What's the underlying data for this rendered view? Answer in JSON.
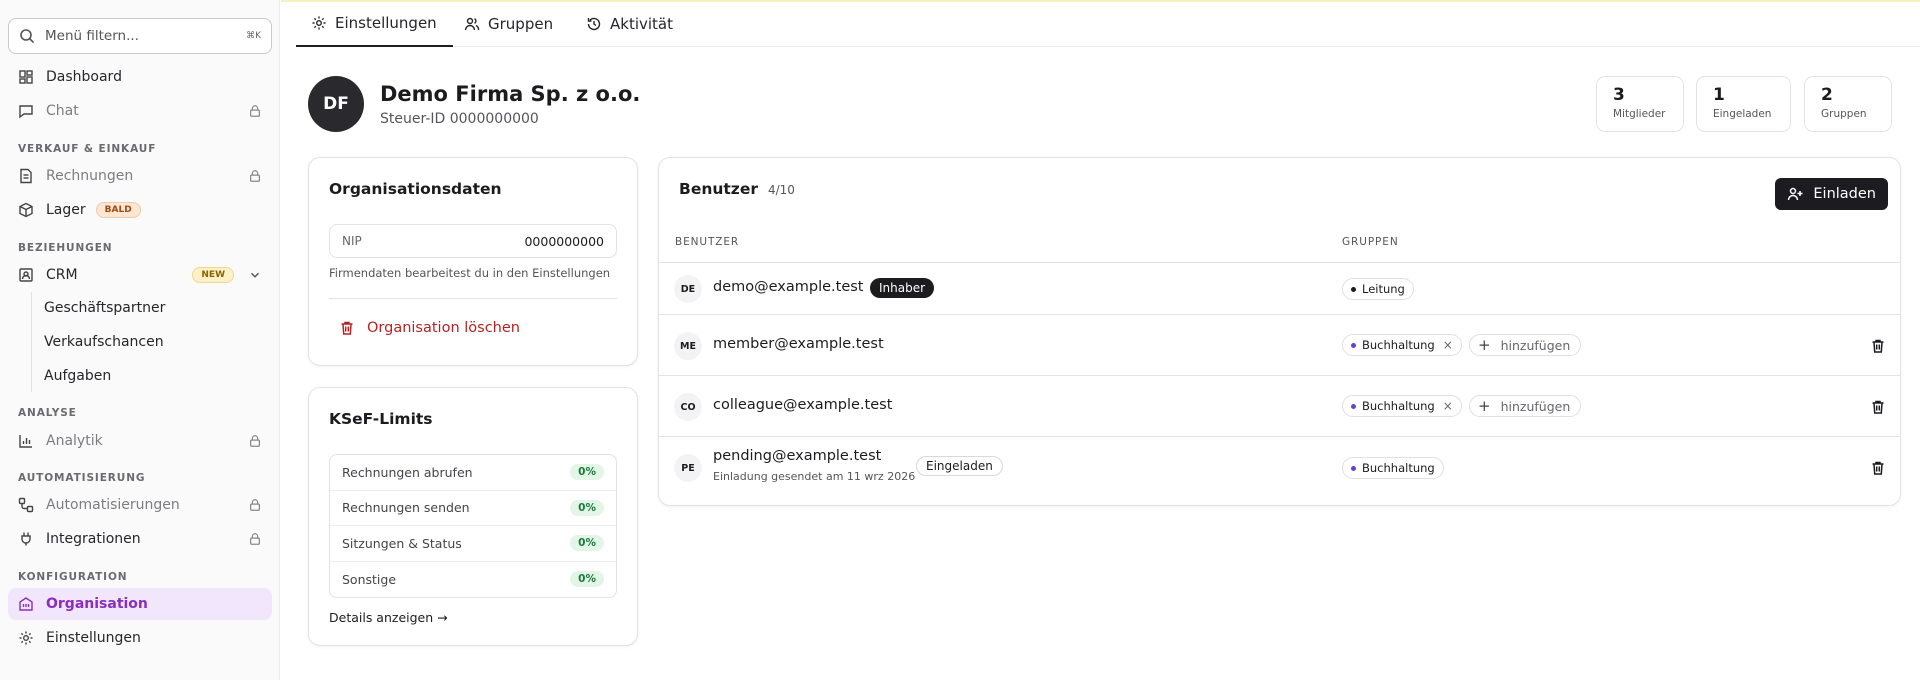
{
  "sidebar": {
    "search_placeholder": "Menü filtern...",
    "search_shortcut": "⌘K",
    "items": {
      "dashboard": "Dashboard",
      "chat": "Chat",
      "rechnungen": "Rechnungen",
      "lager": "Lager",
      "lager_badge": "BALD",
      "crm": "CRM",
      "crm_badge": "NEW",
      "geschaeftspartner": "Geschäftspartner",
      "verkaufschancen": "Verkaufschancen",
      "aufgaben": "Aufgaben",
      "analytik": "Analytik",
      "automatisierungen": "Automatisierungen",
      "integrationen": "Integrationen",
      "organisation": "Organisation",
      "einstellungen": "Einstellungen"
    },
    "sections": {
      "verkauf": "VERKAUF & EINKAUF",
      "beziehungen": "BEZIEHUNGEN",
      "analyse": "ANALYSE",
      "automatisierung": "AUTOMATISIERUNG",
      "konfiguration": "KONFIGURATION"
    }
  },
  "tabs": {
    "einstellungen": "Einstellungen",
    "gruppen": "Gruppen",
    "aktivitaet": "Aktivität"
  },
  "org": {
    "initials": "DF",
    "name": "Demo Firma Sp. z o.o.",
    "tax_id": "Steuer-ID 0000000000"
  },
  "stats": {
    "members": {
      "value": "3",
      "label": "Mitglieder"
    },
    "invited": {
      "value": "1",
      "label": "Eingeladen"
    },
    "groups": {
      "value": "2",
      "label": "Gruppen"
    }
  },
  "org_data": {
    "title": "Organisationsdaten",
    "nip_label": "NIP",
    "nip_value": "0000000000",
    "hint": "Firmendaten bearbeitest du in den Einstellungen",
    "delete_label": "Organisation löschen"
  },
  "ksef": {
    "title": "KSeF-Limits",
    "rows": [
      {
        "label": "Rechnungen abrufen",
        "value": "0%"
      },
      {
        "label": "Rechnungen senden",
        "value": "0%"
      },
      {
        "label": "Sitzungen & Status",
        "value": "0%"
      },
      {
        "label": "Sonstige",
        "value": "0%"
      }
    ],
    "details_link": "Details anzeigen →"
  },
  "users": {
    "title": "Benutzer",
    "count": "4/10",
    "invite_label": "Einladen",
    "col_user": "BENUTZER",
    "col_groups": "GRUPPEN",
    "add_label": "hinzufügen",
    "owner_badge": "Inhaber",
    "pending_badge": "Eingeladen",
    "rows": [
      {
        "initials": "DE",
        "email": "demo@example.test",
        "group": "Leitung",
        "group_color": "#1c1c20"
      },
      {
        "initials": "ME",
        "email": "member@example.test",
        "group": "Buchhaltung",
        "group_color": "#6b3fd1"
      },
      {
        "initials": "CO",
        "email": "colleague@example.test",
        "group": "Buchhaltung",
        "group_color": "#6b3fd1"
      },
      {
        "initials": "PE",
        "email": "pending@example.test",
        "sub": "Einladung gesendet am 11 wrz 2026",
        "group": "Buchhaltung",
        "group_color": "#6b3fd1"
      }
    ]
  },
  "colors": {
    "accent": "#8a2ebf",
    "danger": "#b42323",
    "success": "#1d7a3c"
  }
}
